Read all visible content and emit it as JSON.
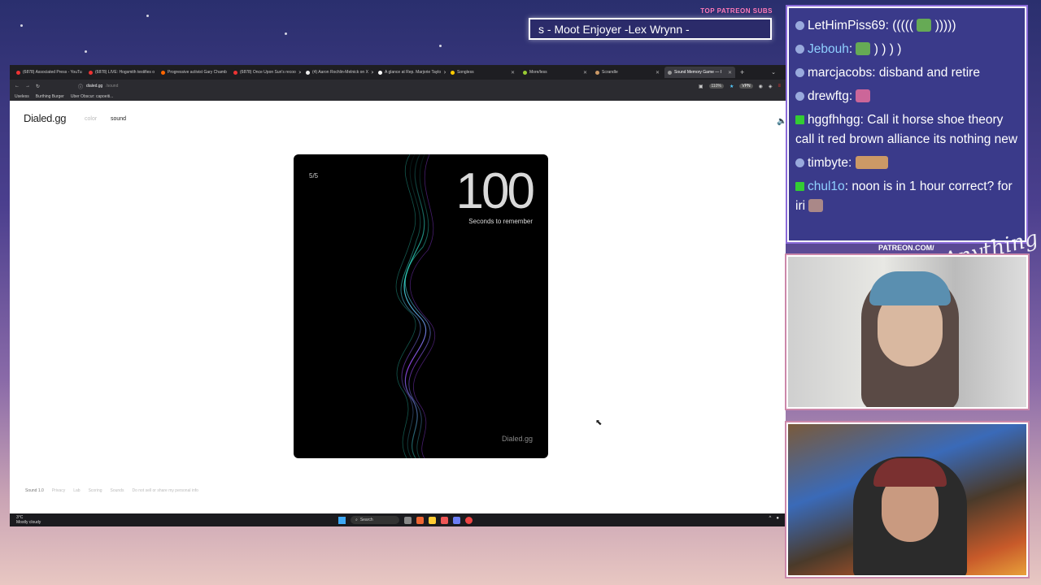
{
  "overlay": {
    "patreon_label": "TOP PATREON SUBS",
    "ticker_text": "s - Moot Enjoyer -Lex Wrynn -",
    "patreon_url": "PATREON.COM/",
    "brand_script": "Anything Else"
  },
  "browser": {
    "tabs": [
      {
        "label": "(6878) Associated Press - YouTu"
      },
      {
        "label": "(6878) LIVE: Hogsmith testifies o"
      },
      {
        "label": "Progressive activist Gary Chamb"
      },
      {
        "label": "(6878) Once Upon Sun's recoo"
      },
      {
        "label": "(4) Aaron Rochlin-Melnick on X"
      },
      {
        "label": "A glance at Rep. Marjorie Taylo"
      },
      {
        "label": "Songless"
      },
      {
        "label": "More/less"
      },
      {
        "label": "Scrandle"
      },
      {
        "label": "Sound Memory Game — I"
      }
    ],
    "url_host": "dialed.gg",
    "url_path": "/sound",
    "zoom": "110%",
    "vpn_label": "VPN",
    "bookmarks": [
      "Useless",
      "Burthing Burger",
      "Uber Obscur: capoeiti..."
    ]
  },
  "page": {
    "logo": "Dialed.gg",
    "nav_color": "color",
    "nav_sound": "sound",
    "card": {
      "round": "5/5",
      "countdown": "100",
      "countdown_label": "Seconds to remember",
      "brand": "Dialed.gg"
    },
    "footer": [
      "Sound 1.0",
      "Privacy",
      "Lab",
      "Scoring",
      "Sounds",
      "Do not sell or share my personal info"
    ]
  },
  "taskbar": {
    "weather_temp": "3°C",
    "weather_desc": "Mostly cloudy",
    "search": "Search"
  },
  "chat": [
    {
      "user": "LetHimPiss69",
      "text": "(((((",
      "text2": ")))))",
      "badge": "blue",
      "emote": true
    },
    {
      "user": "Jebouh",
      "text": "",
      "text2": ") ) ) )",
      "badge": "blue",
      "emote": true,
      "user_color": "blue"
    },
    {
      "user": "marcjacobs",
      "text": "disband and retire",
      "badge": "blue"
    },
    {
      "user": "drewftg",
      "text": "",
      "badge": "blue",
      "emote": true
    },
    {
      "user": "hggfhhgg",
      "text": "Call it horse shoe theory call it red brown alliance its nothing new",
      "badge": "green"
    },
    {
      "user": "timbyte",
      "text": "",
      "badge": "blue",
      "emote": true
    },
    {
      "user": "chul1o",
      "text": "noon is in 1 hour correct? for iri",
      "badge": "green",
      "user_color": "blue",
      "emote": true
    }
  ],
  "colors": {
    "chat_bg": "#3a3a8a",
    "card_bg": "#000000",
    "wave_teal": "#2fd6c0",
    "wave_purple": "#8a3ad8"
  }
}
